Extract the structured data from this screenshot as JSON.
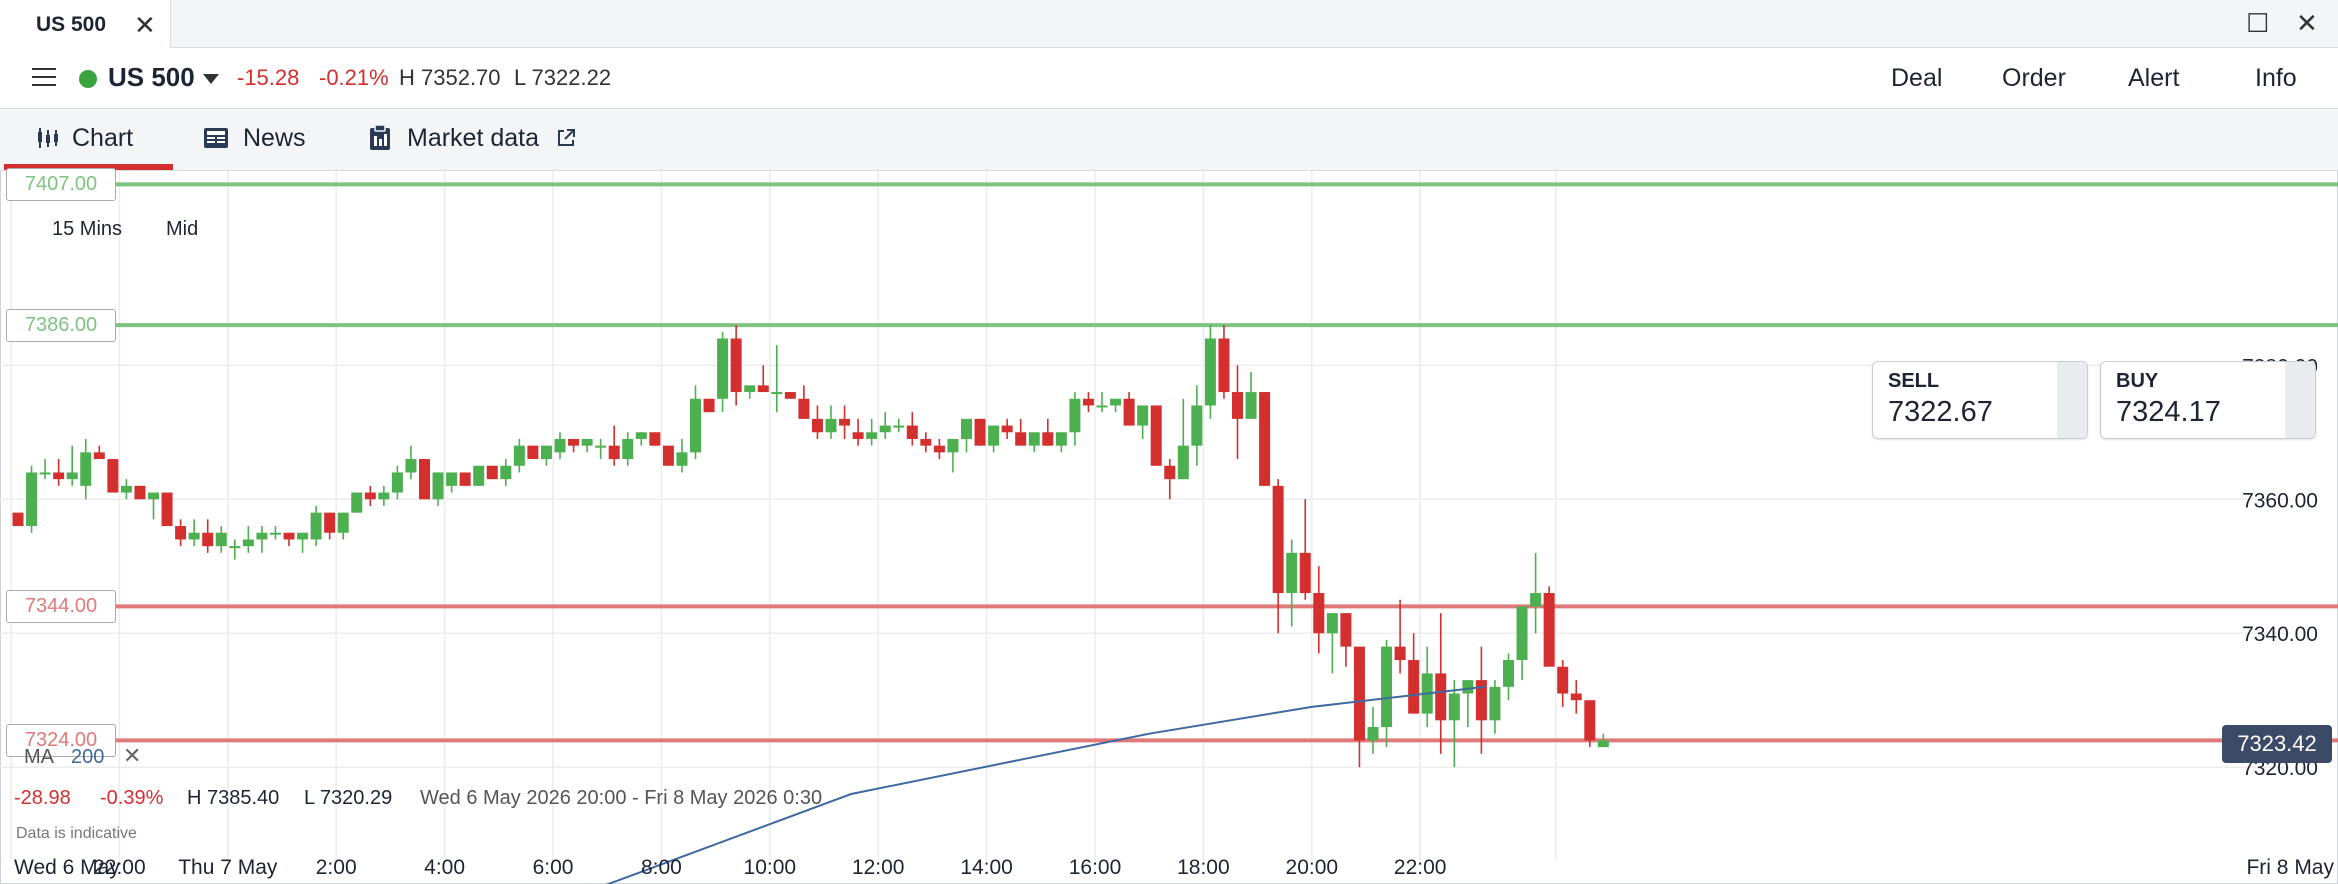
{
  "window": {
    "tab_title": "US 500",
    "tab_close": "✕",
    "maximize": "☐",
    "close": "✕"
  },
  "header": {
    "instrument": "US 500",
    "status_color": "#3aa53f",
    "change": "-15.28",
    "change_pct": "-0.21%",
    "high": "H 7352.70",
    "low": "L 7322.22",
    "actions": [
      "Deal",
      "Order",
      "Alert",
      "Info"
    ]
  },
  "nav": {
    "tabs": [
      {
        "label": "Chart",
        "icon": "candlestick-icon",
        "active": true
      },
      {
        "label": "News",
        "icon": "news-icon",
        "active": false
      },
      {
        "label": "Market data",
        "icon": "clipboard-icon",
        "active": false
      }
    ],
    "accent": "#d32f2f"
  },
  "chart": {
    "timeframe": "15 Mins",
    "price_type": "Mid",
    "quote": {
      "sell_label": "SELL",
      "sell": "7322.67",
      "buy_label": "BUY",
      "buy": "7324.17"
    },
    "current_price": "7323.42",
    "levels": [
      {
        "label": "7407.00",
        "value": 7407,
        "color": "#7cc47f"
      },
      {
        "label": "7386.00",
        "value": 7386,
        "color": "#7cc47f"
      },
      {
        "label": "7344.00",
        "value": 7344,
        "color": "#e07a7a"
      },
      {
        "label": "7324.00",
        "value": 7324,
        "color": "#e07a7a"
      }
    ],
    "indicator": {
      "name": "MA",
      "period": "200",
      "remove": "✕",
      "color": "#3e6aa0"
    },
    "summary": {
      "change": "-28.98",
      "change_pct": "-0.39%",
      "high": "H 7385.40",
      "low": "L 7320.29",
      "range": "Wed 6 May 2026 20:00 - Fri 8 May 2026 0:30"
    },
    "disclaimer": "Data is indicative",
    "up_color": "#4caf50",
    "down_color": "#d32f2f"
  },
  "chart_data": {
    "type": "candlestick",
    "x_start": "Wed 6 May 2026 20:00",
    "interval": "15 Mins",
    "y_ticks": [
      "7380.00",
      "7360.00",
      "7340.00",
      "7320.00"
    ],
    "y_tick_values": [
      7380,
      7360,
      7340,
      7320
    ],
    "ylim": [
      7306,
      7409
    ],
    "x_ticks": [
      "Wed 6 May",
      "22:00",
      "Thu 7 May",
      "2:00",
      "4:00",
      "6:00",
      "8:00",
      "10:00",
      "12:00",
      "14:00",
      "16:00",
      "18:00",
      "20:00",
      "22:00",
      "Fri 8 May"
    ],
    "x_tick_hours": [
      0,
      2,
      4,
      6,
      8,
      10,
      12,
      14,
      16,
      18,
      20,
      22,
      24,
      26,
      28.5
    ],
    "candles": [
      [
        7358,
        7358,
        7356,
        7356
      ],
      [
        7356,
        7365,
        7355,
        7364
      ],
      [
        7364,
        7366,
        7363,
        7364
      ],
      [
        7364,
        7366,
        7362,
        7363
      ],
      [
        7363,
        7368,
        7362,
        7364
      ],
      [
        7362,
        7369,
        7360,
        7367
      ],
      [
        7367,
        7368,
        7366,
        7366
      ],
      [
        7366,
        7366,
        7361,
        7361
      ],
      [
        7361,
        7363,
        7360,
        7362
      ],
      [
        7362,
        7362,
        7360,
        7360
      ],
      [
        7360,
        7361,
        7357,
        7361
      ],
      [
        7361,
        7361,
        7356,
        7356
      ],
      [
        7356,
        7357,
        7353,
        7354
      ],
      [
        7354,
        7357,
        7353,
        7355
      ],
      [
        7355,
        7357,
        7352,
        7353
      ],
      [
        7353,
        7356,
        7352,
        7355
      ],
      [
        7353,
        7354,
        7351,
        7353
      ],
      [
        7353,
        7356,
        7352,
        7354
      ],
      [
        7354,
        7356,
        7352,
        7355
      ],
      [
        7355,
        7356,
        7354,
        7355
      ],
      [
        7355,
        7355,
        7353,
        7354
      ],
      [
        7354,
        7355,
        7352,
        7355
      ],
      [
        7354,
        7359,
        7353,
        7358
      ],
      [
        7358,
        7358,
        7354,
        7355
      ],
      [
        7355,
        7358,
        7354,
        7358
      ],
      [
        7358,
        7361,
        7358,
        7361
      ],
      [
        7361,
        7362,
        7359,
        7360
      ],
      [
        7360,
        7362,
        7359,
        7361
      ],
      [
        7361,
        7365,
        7360,
        7364
      ],
      [
        7364,
        7368,
        7363,
        7366
      ],
      [
        7366,
        7366,
        7360,
        7360
      ],
      [
        7360,
        7364,
        7359,
        7364
      ],
      [
        7362,
        7364,
        7361,
        7364
      ],
      [
        7364,
        7364,
        7362,
        7362
      ],
      [
        7362,
        7365,
        7362,
        7365
      ],
      [
        7365,
        7365,
        7363,
        7363
      ],
      [
        7363,
        7366,
        7362,
        7365
      ],
      [
        7365,
        7369,
        7364,
        7368
      ],
      [
        7368,
        7368,
        7366,
        7366
      ],
      [
        7366,
        7368,
        7365,
        7368
      ],
      [
        7367,
        7370,
        7366,
        7369
      ],
      [
        7369,
        7369,
        7367,
        7368
      ],
      [
        7368,
        7369,
        7367,
        7369
      ],
      [
        7368,
        7369,
        7366,
        7368
      ],
      [
        7368,
        7371,
        7365,
        7366
      ],
      [
        7366,
        7370,
        7365,
        7369
      ],
      [
        7369,
        7370,
        7368,
        7370
      ],
      [
        7370,
        7370,
        7368,
        7368
      ],
      [
        7368,
        7368,
        7365,
        7365
      ],
      [
        7365,
        7369,
        7364,
        7367
      ],
      [
        7367,
        7377,
        7366,
        7375
      ],
      [
        7375,
        7375,
        7373,
        7373
      ],
      [
        7375,
        7385,
        7373,
        7384
      ],
      [
        7384,
        7386,
        7374,
        7376
      ],
      [
        7376,
        7377,
        7375,
        7377
      ],
      [
        7377,
        7380,
        7376,
        7376
      ],
      [
        7376,
        7383,
        7373,
        7376
      ],
      [
        7376,
        7376,
        7375,
        7375
      ],
      [
        7375,
        7377,
        7372,
        7372
      ],
      [
        7372,
        7374,
        7369,
        7370
      ],
      [
        7370,
        7374,
        7369,
        7372
      ],
      [
        7372,
        7374,
        7369,
        7371
      ],
      [
        7370,
        7372,
        7368,
        7369
      ],
      [
        7369,
        7372,
        7368,
        7370
      ],
      [
        7370,
        7373,
        7369,
        7371
      ],
      [
        7371,
        7372,
        7370,
        7371
      ],
      [
        7371,
        7373,
        7368,
        7369
      ],
      [
        7369,
        7370,
        7367,
        7368
      ],
      [
        7368,
        7369,
        7366,
        7367
      ],
      [
        7367,
        7369,
        7364,
        7369
      ],
      [
        7369,
        7372,
        7367,
        7372
      ],
      [
        7372,
        7372,
        7368,
        7368
      ],
      [
        7368,
        7370,
        7367,
        7371
      ],
      [
        7371,
        7372,
        7369,
        7370
      ],
      [
        7370,
        7372,
        7368,
        7368
      ],
      [
        7368,
        7369,
        7367,
        7370
      ],
      [
        7370,
        7372,
        7368,
        7368
      ],
      [
        7368,
        7370,
        7367,
        7370
      ],
      [
        7370,
        7376,
        7368,
        7375
      ],
      [
        7375,
        7376,
        7373,
        7374
      ],
      [
        7374,
        7376,
        7373,
        7374
      ],
      [
        7374,
        7375,
        7373,
        7375
      ],
      [
        7375,
        7376,
        7373,
        7371
      ],
      [
        7371,
        7372,
        7369,
        7374
      ],
      [
        7374,
        7374,
        7365,
        7365
      ],
      [
        7365,
        7366,
        7360,
        7363
      ],
      [
        7363,
        7375,
        7363,
        7368
      ],
      [
        7368,
        7377,
        7365,
        7374
      ],
      [
        7374,
        7386,
        7372,
        7384
      ],
      [
        7384,
        7386,
        7375,
        7376
      ],
      [
        7376,
        7380,
        7366,
        7372
      ],
      [
        7372,
        7379,
        7372,
        7376
      ],
      [
        7376,
        7376,
        7362,
        7362
      ],
      [
        7362,
        7363,
        7340,
        7346
      ],
      [
        7346,
        7354,
        7341,
        7352
      ],
      [
        7352,
        7360,
        7345,
        7346
      ],
      [
        7346,
        7350,
        7337,
        7340
      ],
      [
        7340,
        7343,
        7334,
        7343
      ],
      [
        7343,
        7343,
        7335,
        7338
      ],
      [
        7338,
        7338,
        7320,
        7324
      ],
      [
        7324,
        7329,
        7322,
        7326
      ],
      [
        7326,
        7339,
        7323,
        7338
      ],
      [
        7338,
        7345,
        7334,
        7336
      ],
      [
        7336,
        7340,
        7328,
        7328
      ],
      [
        7328,
        7338,
        7326,
        7334
      ],
      [
        7334,
        7343,
        7322,
        7327
      ],
      [
        7327,
        7333,
        7320,
        7331
      ],
      [
        7331,
        7333,
        7326,
        7333
      ],
      [
        7333,
        7338,
        7322,
        7327
      ],
      [
        7327,
        7333,
        7325,
        7332
      ],
      [
        7332,
        7337,
        7330,
        7336
      ],
      [
        7336,
        7344,
        7333,
        7344
      ],
      [
        7344,
        7352,
        7340,
        7346
      ],
      [
        7346,
        7347,
        7336,
        7335
      ],
      [
        7335,
        7336,
        7329,
        7331
      ],
      [
        7331,
        7333,
        7328,
        7330
      ],
      [
        7330,
        7330,
        7323,
        7324
      ],
      [
        7323,
        7325,
        7323,
        7324
      ]
    ],
    "ma_200": [
      {
        "x_hours": 9.5,
        "y": 7298
      },
      {
        "x_hours": 15.5,
        "y": 7316
      },
      {
        "x_hours": 21.0,
        "y": 7325
      },
      {
        "x_hours": 24.0,
        "y": 7329
      },
      {
        "x_hours": 27.2,
        "y": 7332
      }
    ]
  }
}
